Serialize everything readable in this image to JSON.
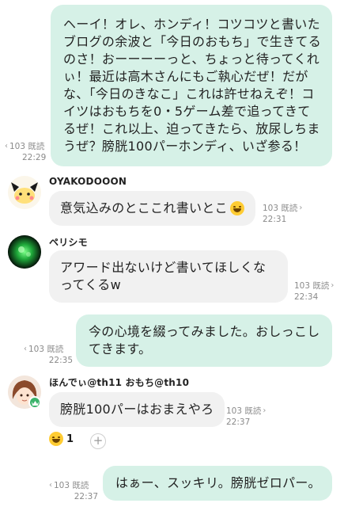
{
  "messages": [
    {
      "side": "out",
      "text": "ヘーイ！オレ、ホンディ！コツコツと書いたブログの余波と「今日のおもち」で生きてるのさ！おーーーーっと、ちょっと待ってくれぃ！最近は高木さんにもご執心だぜ！だがな、「今日のきなこ」これは許せねえぞ！コイツはおもちを0・5ゲーム差で追ってきてるぜ！これ以上、迫ってきたら、放尿しちまうぜ？膀胱100パーホンディ、いざ参る！",
      "read": "103 既読",
      "time": "22:29"
    },
    {
      "side": "in",
      "sender": "OYAKODOOON",
      "avatar_icon": "cartoon-character-avatar",
      "text": "意気込みのとここれ書いとこ",
      "emoji": "grinning-face-icon",
      "read": "103 既読",
      "time": "22:31"
    },
    {
      "side": "in",
      "sender": "ペリシモ",
      "avatar_icon": "green-glow-avatar",
      "text": "アワード出ないけど書いてほしくなってくるw",
      "read": "103 既読",
      "time": "22:34"
    },
    {
      "side": "out",
      "text": "今の心境を綴ってみました。おしっこしてきます。",
      "read": "103 既読",
      "time": "22:35"
    },
    {
      "side": "in",
      "sender": "ほんでぃ@th11 おもち@th10",
      "avatar_icon": "anime-girl-avatar",
      "text": "膀胱100パーはおまえやろ",
      "read": "103 既読",
      "time": "22:37",
      "reaction": {
        "icon": "grinning-squint-face-icon",
        "count": "1",
        "add_icon": "plus-icon"
      }
    },
    {
      "side": "out",
      "text": "はぁー、スッキリ。膀胱ゼロパー。",
      "read": "103 既読",
      "time": "22:37"
    }
  ],
  "colors": {
    "outgoing_bubble": "#d6f1e7",
    "incoming_bubble": "#f1f1f1",
    "meta_text": "#8a8a8a",
    "badge_green": "#3bb36b"
  }
}
